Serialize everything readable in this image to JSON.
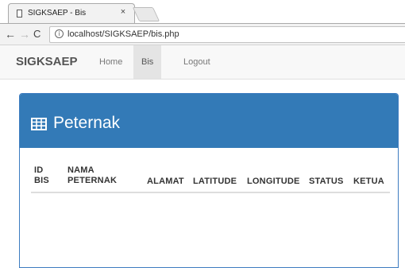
{
  "browser": {
    "tab_title": "SIGKSAEP - Bis",
    "tab_close": "×",
    "back_glyph": "←",
    "forward_glyph": "→",
    "reload_glyph": "C",
    "info_glyph": "i",
    "url": "localhost/SIGKSAEP/bis.php"
  },
  "navbar": {
    "brand": "SIGKSAEP",
    "links": [
      {
        "label": "Home",
        "active": false
      },
      {
        "label": "Bis",
        "active": true
      },
      {
        "label": "Logout",
        "active": false
      }
    ]
  },
  "panel": {
    "title": "Peternak",
    "icon": "table-icon",
    "heading_color": "#337ab7",
    "columns": [
      {
        "line1": "ID",
        "line2": "BIS"
      },
      {
        "line1": "NAMA",
        "line2": "PETERNAK"
      },
      {
        "line1": "ALAMAT"
      },
      {
        "line1": "LATITUDE"
      },
      {
        "line1": "LONGITUDE"
      },
      {
        "line1": "STATUS"
      },
      {
        "line1": "KETUA"
      }
    ]
  }
}
